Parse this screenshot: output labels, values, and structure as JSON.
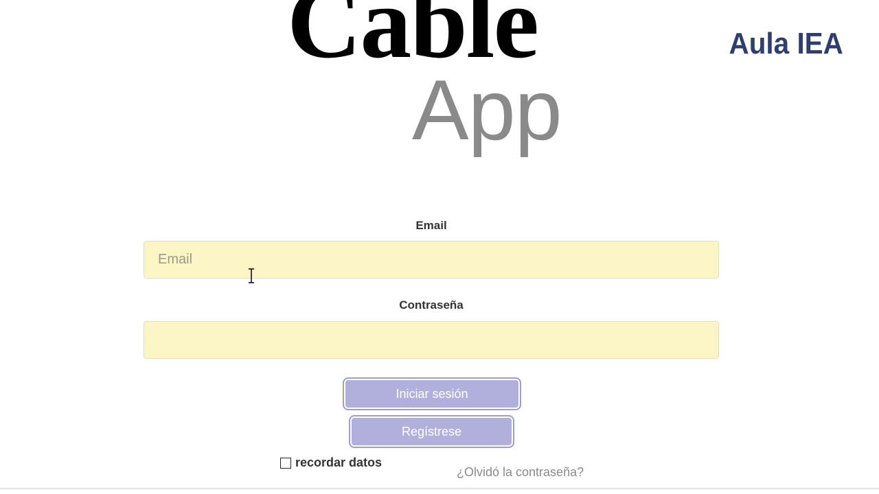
{
  "logo": {
    "line1": "Cable",
    "line2": "App"
  },
  "watermark": "Aula IEA",
  "form": {
    "email_label": "Email",
    "email_placeholder": "Email",
    "email_value": "",
    "password_label": "Contraseña",
    "password_value": "",
    "login_button": "Iniciar sesión",
    "register_button": "Regístrese",
    "remember_label": "recordar datos",
    "remember_checked": false,
    "forgot_link": "¿Olvidó la contraseña?"
  },
  "colors": {
    "input_background": "#fcf6c6",
    "button_background": "#b1b0dd",
    "watermark": "#2e3f6f",
    "logo_app": "#8a8a8a"
  }
}
